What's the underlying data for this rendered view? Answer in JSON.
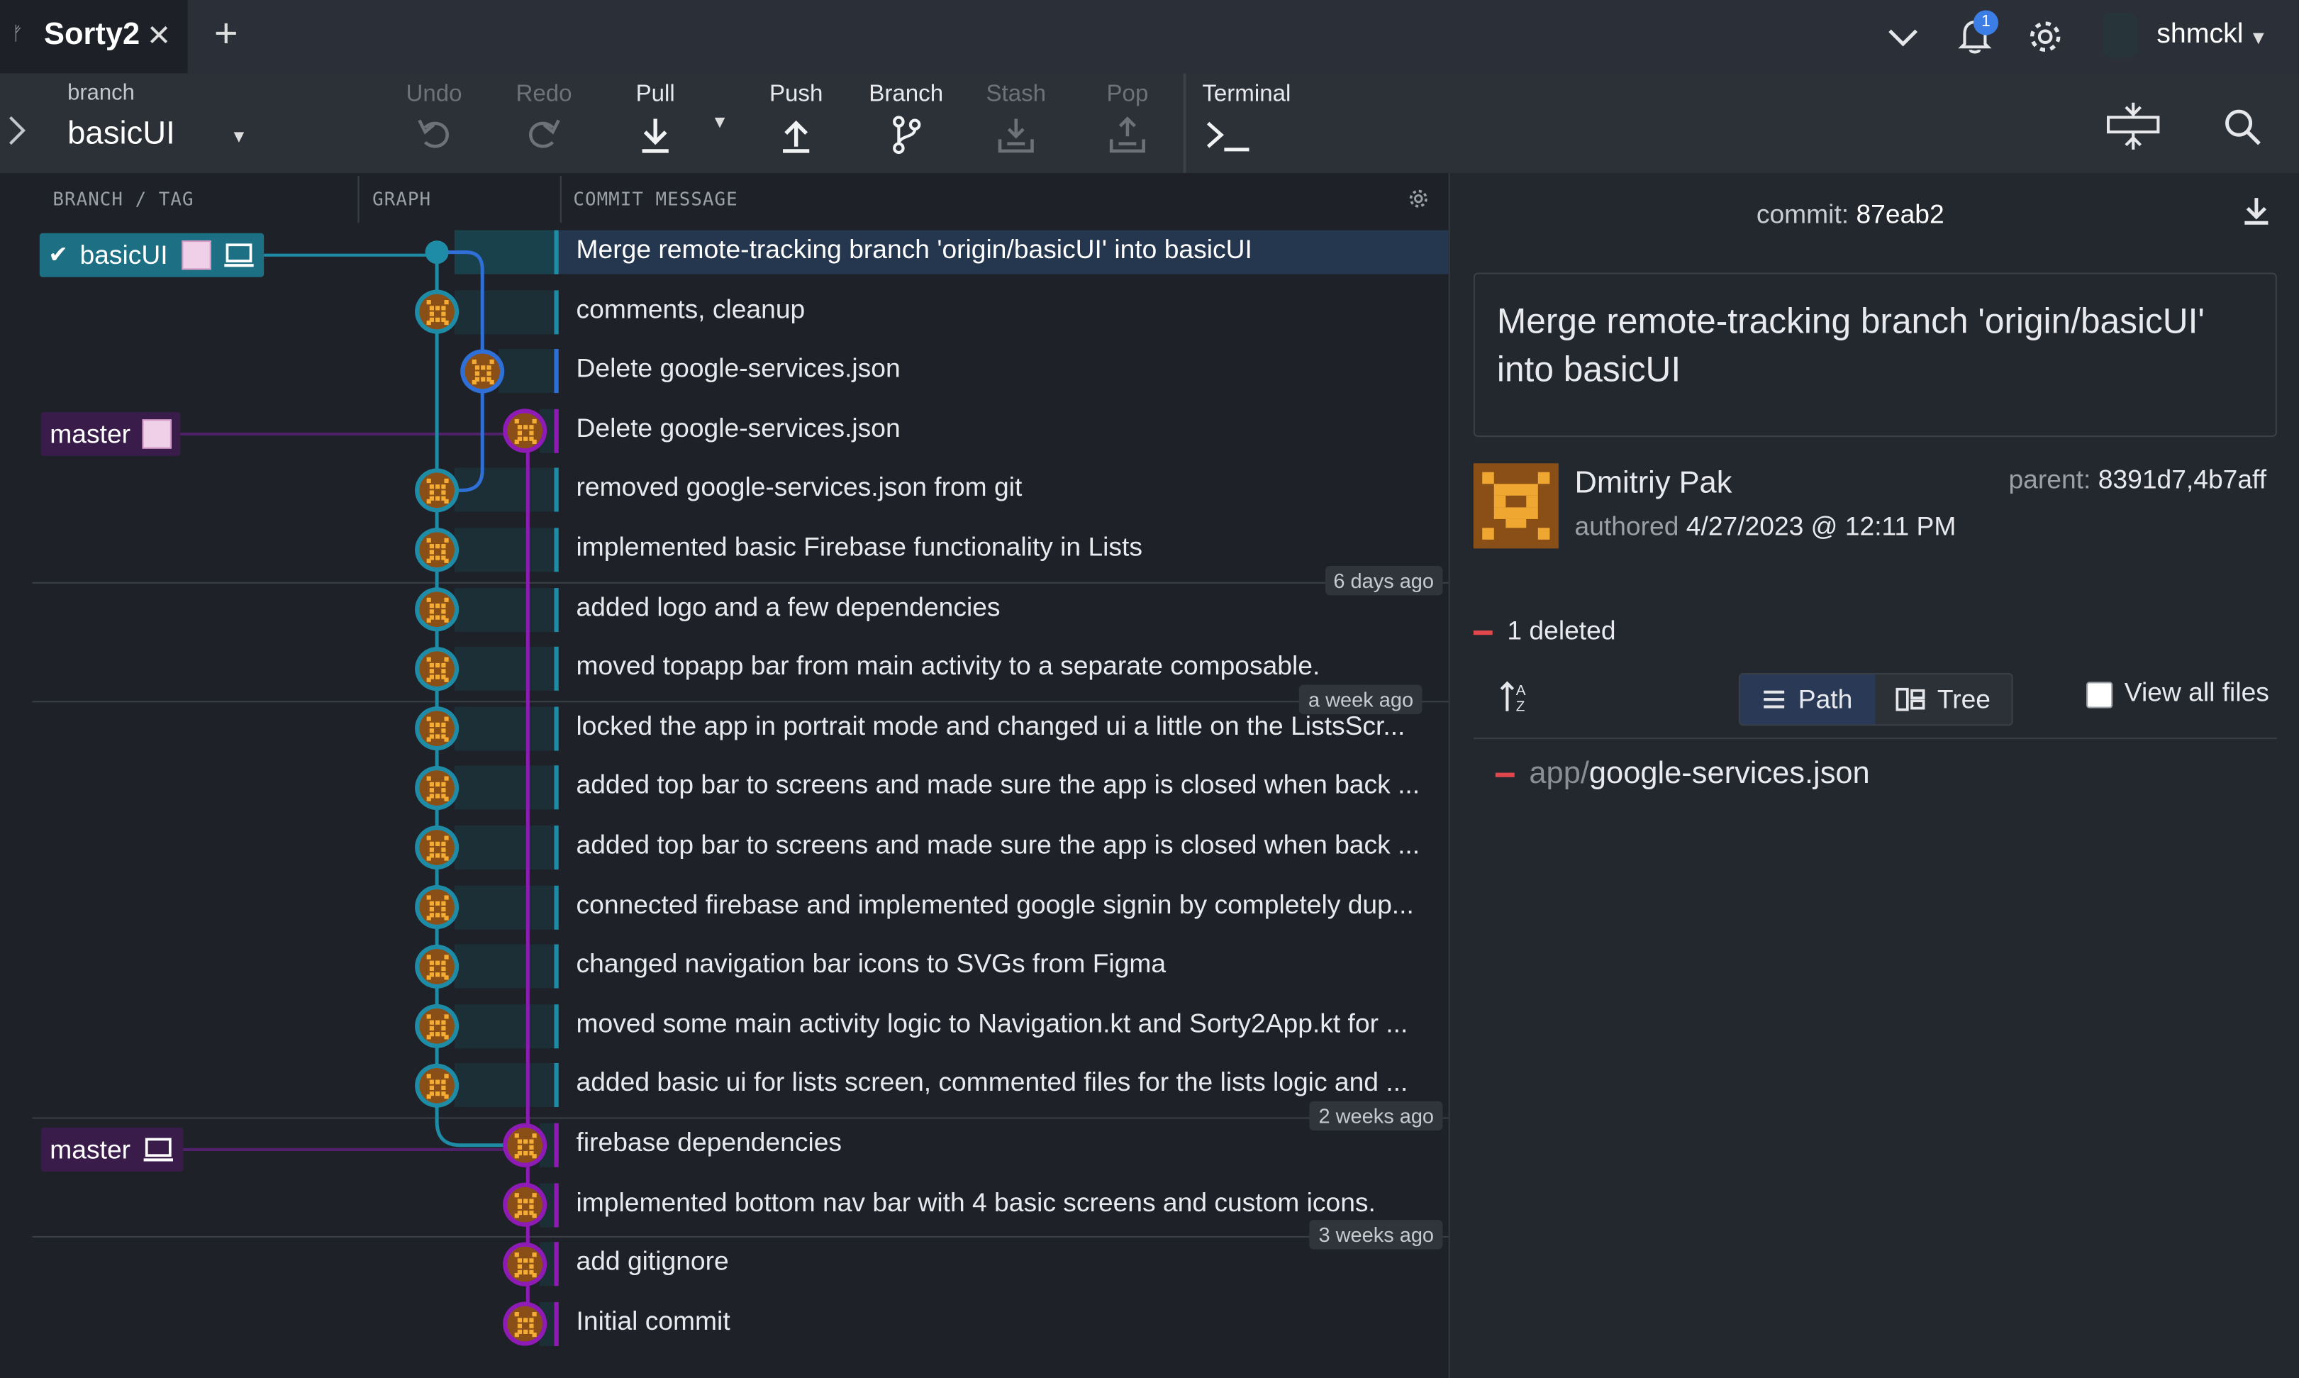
{
  "tabbar": {
    "repo_tab": "Sorty2",
    "username": "shmckl",
    "notification_count": "1"
  },
  "toolbar": {
    "branch_label": "branch",
    "branch_name": "basicUI",
    "buttons": {
      "undo": "Undo",
      "redo": "Redo",
      "pull": "Pull",
      "push": "Push",
      "branch": "Branch",
      "stash": "Stash",
      "pop": "Pop",
      "terminal": "Terminal"
    }
  },
  "graph_panel": {
    "headers": {
      "branch_tag": "BRANCH / TAG",
      "graph": "GRAPH",
      "commit_message": "COMMIT MESSAGE"
    },
    "refs": [
      {
        "name": "basicUI"
      },
      {
        "name": "master"
      },
      {
        "name": "master"
      }
    ],
    "commits": [
      {
        "message": "Merge remote-tracking branch 'origin/basicUI' into basicUI"
      },
      {
        "message": "comments, cleanup"
      },
      {
        "message": "Delete google-services.json"
      },
      {
        "message": "Delete google-services.json"
      },
      {
        "message": "removed google-services.json from git"
      },
      {
        "message": "implemented basic Firebase functionality in Lists"
      },
      {
        "message": "added logo and a few dependencies"
      },
      {
        "message": "moved topapp bar from main activity to a separate composable."
      },
      {
        "message": "locked the app in portrait mode and changed ui a little on the ListsScr..."
      },
      {
        "message": "added top bar to screens and made sure the app is closed when back ..."
      },
      {
        "message": "added top bar to screens and made sure the app is closed when back ..."
      },
      {
        "message": "connected firebase and implemented google signin by completely dup..."
      },
      {
        "message": "changed navigation bar icons to SVGs from Figma"
      },
      {
        "message": "moved some main activity logic to Navigation.kt and Sorty2App.kt for ..."
      },
      {
        "message": "added basic ui for lists screen, commented files for the lists logic and ..."
      },
      {
        "message": "firebase dependencies"
      },
      {
        "message": "implemented bottom nav bar with 4 basic screens and custom icons."
      },
      {
        "message": "add gitignore"
      },
      {
        "message": "Initial commit"
      }
    ],
    "time_markers": [
      "6 days ago",
      "a week ago",
      "2 weeks ago",
      "3 weeks ago"
    ],
    "colors": {
      "basicUI": "#1f8ca7",
      "master": "#8e1bb6",
      "merged_branch": "#2f6fd8"
    }
  },
  "detail_panel": {
    "commit_label": "commit:",
    "commit_sha": "87eab2",
    "message": "Merge remote-tracking branch 'origin/basicUI' into basicUI",
    "author": "Dmitriy Pak",
    "authored_label": "authored",
    "authored_date": "4/27/2023 @ 12:11 PM",
    "parent_label": "parent:",
    "parents": "8391d7,4b7aff",
    "change_summary": "1 deleted",
    "view_path": "Path",
    "view_tree": "Tree",
    "view_all_files": "View all files",
    "file_dir": "app/",
    "file_name": "google-services.json"
  }
}
